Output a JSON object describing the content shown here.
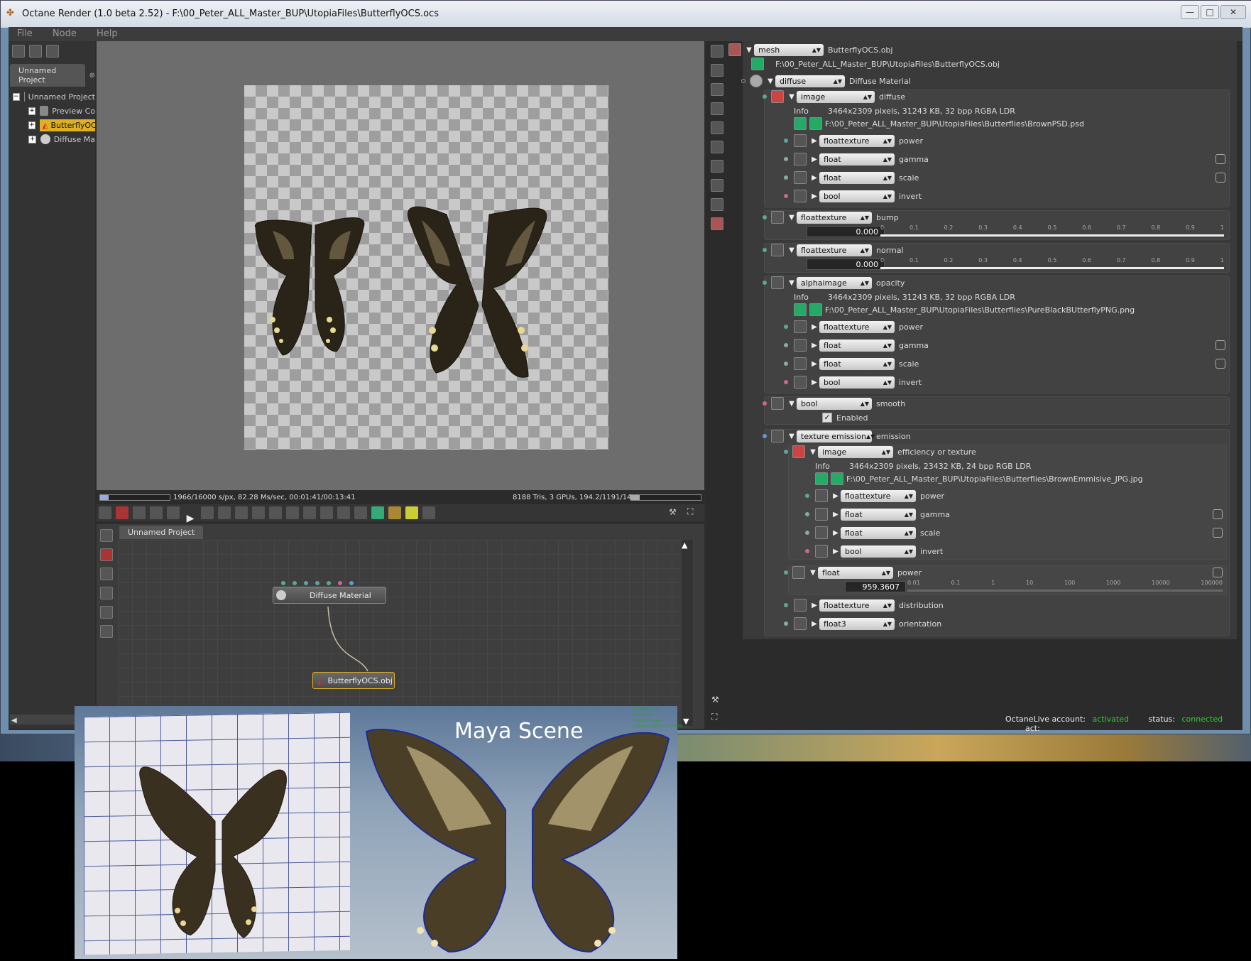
{
  "window": {
    "title": "Octane Render (1.0 beta 2.52) - F:\\00_Peter_ALL_Master_BUP\\UtopiaFiles\\ButterflyOCS.ocs",
    "buttons": [
      "—",
      "□",
      "✕"
    ]
  },
  "menu": [
    "File",
    "Node",
    "Help"
  ],
  "scene_tree": {
    "tab": "Unnamed Project",
    "items": [
      "Unnamed Project",
      "Preview Co",
      "ButterflyOCS.obj",
      "Diffuse Ma"
    ]
  },
  "render": {
    "status": "1966/16000 s/px, 82.28 Ms/sec, 00:01:41/00:13:41",
    "stats": "8188 Tris, 3 GPUs, 194.2/1191/1471 MB",
    "progress": 0.12
  },
  "nodegraph": {
    "tab": "Unnamed Project",
    "node_material": "Diffuse Material",
    "node_mesh": "ButterflyOCS.obj"
  },
  "inspector": {
    "mesh": {
      "type": "mesh",
      "label": "ButterflyOCS.obj",
      "path": "F:\\00_Peter_ALL_Master_BUP\\UtopiaFiles\\ButterflyOCS.obj"
    },
    "diffuse": {
      "type": "diffuse",
      "label": "Diffuse Material"
    },
    "diffuse_image": {
      "type": "image",
      "label": "diffuse",
      "info_label": "Info",
      "info": "3464x2309 pixels, 31243 KB, 32 bpp RGBA LDR",
      "path": "F:\\00_Peter_ALL_Master_BUP\\UtopiaFiles\\Butterflies\\BrownPSD.psd",
      "params": [
        {
          "type": "floattexture",
          "label": "power"
        },
        {
          "type": "float",
          "label": "gamma"
        },
        {
          "type": "float",
          "label": "scale"
        },
        {
          "type": "bool",
          "label": "invert"
        }
      ]
    },
    "bump": {
      "type": "floattexture",
      "label": "bump",
      "value": "0.000"
    },
    "normal": {
      "type": "floattexture",
      "label": "normal",
      "value": "0.000"
    },
    "slider_ticks": [
      "0",
      "0.1",
      "0.2",
      "0.3",
      "0.4",
      "0.5",
      "0.6",
      "0.7",
      "0.8",
      "0.9",
      "1"
    ],
    "opacity": {
      "type": "alphaimage",
      "label": "opacity",
      "info_label": "Info",
      "info": "3464x2309 pixels, 31243 KB, 32 bpp RGBA LDR",
      "path": "F:\\00_Peter_ALL_Master_BUP\\UtopiaFiles\\Butterflies\\PureBlackBUtterflyPNG.png",
      "params": [
        {
          "type": "floattexture",
          "label": "power"
        },
        {
          "type": "float",
          "label": "gamma"
        },
        {
          "type": "float",
          "label": "scale"
        },
        {
          "type": "bool",
          "label": "invert"
        }
      ]
    },
    "smooth": {
      "type": "bool",
      "label": "smooth",
      "checkbox": "Enabled",
      "check": "✓"
    },
    "emission": {
      "type": "texture emission",
      "label": "emission"
    },
    "emission_image": {
      "type": "image",
      "label": "efficiency or texture",
      "info_label": "Info",
      "info": "3464x2309 pixels, 23432 KB, 24 bpp RGB LDR",
      "path": "F:\\00_Peter_ALL_Master_BUP\\UtopiaFiles\\Butterflies\\BrownEmmisive_JPG.jpg",
      "params": [
        {
          "type": "floattexture",
          "label": "power"
        },
        {
          "type": "float",
          "label": "gamma"
        },
        {
          "type": "float",
          "label": "scale"
        },
        {
          "type": "bool",
          "label": "invert"
        }
      ]
    },
    "emission_power": {
      "type": "float",
      "label": "power",
      "value": "959.3607",
      "ticks": [
        "0.01",
        "0.1",
        "1",
        "10",
        "100",
        "1000",
        "10000",
        "100000"
      ]
    },
    "distribution": {
      "type": "floattexture",
      "label": "distribution"
    },
    "orientation": {
      "type": "float3",
      "label": "orientation"
    }
  },
  "status_bar": {
    "account_label": "OctaneLive account:",
    "account_value": "activated",
    "status_label": "status:",
    "status_value": "connected",
    "act_label": "act:"
  },
  "maya": {
    "title": "Maya Scene",
    "hud": [
      "Smoothness:",
      "Instance:",
      "Display Layer:",
      "Distance From Camera:"
    ]
  },
  "colors": {
    "accent_green": "#2ecc2e",
    "octane_orange": "#e0b020"
  }
}
